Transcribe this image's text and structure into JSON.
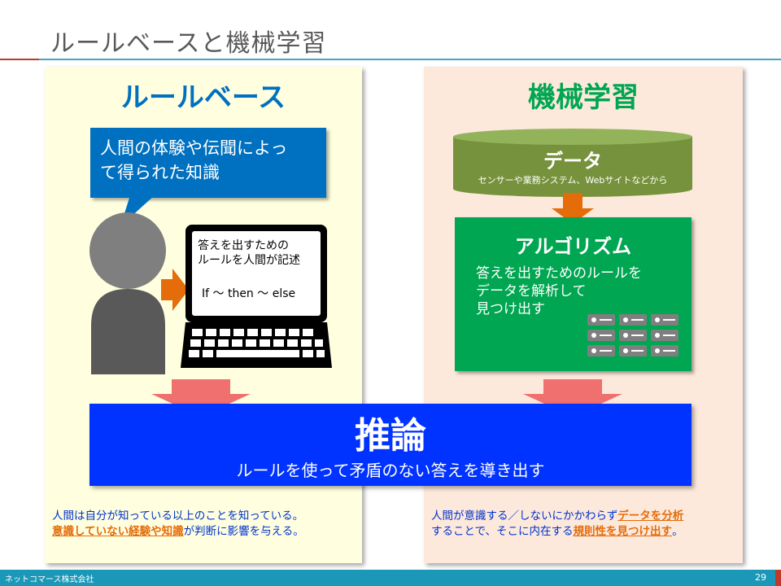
{
  "slide": {
    "title": "ルールベースと機械学習",
    "footer_company": "ネットコマース株式会社",
    "page_number": "29"
  },
  "rule_based": {
    "heading": "ルールベース",
    "bubble_line1": "人間の体験や伝聞によっ",
    "bubble_line2": "て得られた知識",
    "laptop_note_line1": "答えを出すための",
    "laptop_note_line2": "ルールを人間が記述",
    "laptop_code": "If 〜 then 〜 else",
    "bottom_line1": "人間は自分が知っている以上のことを知っている。",
    "bottom_hl": "意識していない経験や知識",
    "bottom_rest": "が判断に影響を与える。"
  },
  "machine_learning": {
    "heading": "機械学習",
    "data_title": "データ",
    "data_subtitle": "センサーや業務システム、Webサイトなどから",
    "algo_title": "アルゴリズム",
    "algo_line1": "答えを出すためのルールを",
    "algo_line2": "データを解析して",
    "algo_line3": "見つけ出す",
    "bottom_pre": "人間が意識する／しないにかかわらず",
    "bottom_hl1": "データを分析",
    "bottom_mid": "することで、そこに内在する",
    "bottom_hl2": "規則性を見つけ出す",
    "bottom_end": "。"
  },
  "inference": {
    "title": "推論",
    "subtitle": "ルールを使って矛盾のない答えを導き出す"
  },
  "colors": {
    "rule_accent": "#0070c0",
    "ml_accent": "#00a651",
    "data_olive": "#76923c",
    "arrow_orange": "#e46c0a",
    "arrow_salmon": "#f07070",
    "inference_blue": "#0033ff",
    "footer": "#1b98b7"
  }
}
